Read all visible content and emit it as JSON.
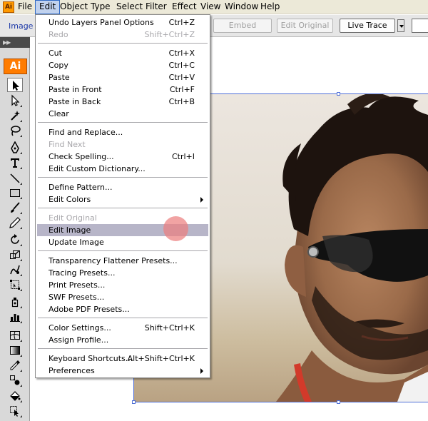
{
  "app": {
    "icon": "Ai"
  },
  "menubar": {
    "items": [
      "File",
      "Edit",
      "Object",
      "Type",
      "Select",
      "Filter",
      "Effect",
      "View",
      "Window",
      "Help"
    ],
    "active": "Edit"
  },
  "controlbar": {
    "selection_label": "Image",
    "embed": "Embed",
    "edit_original": "Edit Original",
    "live_trace": "Live Trace"
  },
  "tools": {
    "logo": "Ai",
    "icons": [
      "selection-tool-icon",
      "direct-selection-tool-icon",
      "magic-wand-tool-icon",
      "lasso-tool-icon",
      "pen-tool-icon",
      "type-tool-icon",
      "line-segment-tool-icon",
      "rectangle-tool-icon",
      "paintbrush-tool-icon",
      "pencil-tool-icon",
      "rotate-tool-icon",
      "scale-tool-icon",
      "warp-tool-icon",
      "free-transform-tool-icon",
      "symbol-sprayer-tool-icon",
      "column-graph-tool-icon",
      "mesh-tool-icon",
      "gradient-tool-icon",
      "eyedropper-tool-icon",
      "blend-tool-icon",
      "live-paint-bucket-tool-icon",
      "live-paint-selection-tool-icon"
    ]
  },
  "edit_menu": {
    "items": [
      {
        "label": "Undo Layers Panel Options",
        "shortcut": "Ctrl+Z",
        "enabled": true
      },
      {
        "label": "Redo",
        "shortcut": "Shift+Ctrl+Z",
        "enabled": false
      },
      {
        "label": "Cut",
        "shortcut": "Ctrl+X",
        "enabled": true
      },
      {
        "label": "Copy",
        "shortcut": "Ctrl+C",
        "enabled": true
      },
      {
        "label": "Paste",
        "shortcut": "Ctrl+V",
        "enabled": true
      },
      {
        "label": "Paste in Front",
        "shortcut": "Ctrl+F",
        "enabled": true
      },
      {
        "label": "Paste in Back",
        "shortcut": "Ctrl+B",
        "enabled": true
      },
      {
        "label": "Clear",
        "shortcut": "",
        "enabled": true
      },
      {
        "label": "Find and Replace...",
        "shortcut": "",
        "enabled": true
      },
      {
        "label": "Find Next",
        "shortcut": "",
        "enabled": false
      },
      {
        "label": "Check Spelling...",
        "shortcut": "Ctrl+I",
        "enabled": true
      },
      {
        "label": "Edit Custom Dictionary...",
        "shortcut": "",
        "enabled": true
      },
      {
        "label": "Define Pattern...",
        "shortcut": "",
        "enabled": true
      },
      {
        "label": "Edit Colors",
        "shortcut": "",
        "enabled": true,
        "submenu": true
      },
      {
        "label": "Edit Original",
        "shortcut": "",
        "enabled": false
      },
      {
        "label": "Edit Image",
        "shortcut": "",
        "enabled": true,
        "highlighted": true
      },
      {
        "label": "Update Image",
        "shortcut": "",
        "enabled": true
      },
      {
        "label": "Transparency Flattener Presets...",
        "shortcut": "",
        "enabled": true
      },
      {
        "label": "Tracing Presets...",
        "shortcut": "",
        "enabled": true
      },
      {
        "label": "Print Presets...",
        "shortcut": "",
        "enabled": true
      },
      {
        "label": "SWF Presets...",
        "shortcut": "",
        "enabled": true
      },
      {
        "label": "Adobe PDF Presets...",
        "shortcut": "",
        "enabled": true
      },
      {
        "label": "Color Settings...",
        "shortcut": "Shift+Ctrl+K",
        "enabled": true
      },
      {
        "label": "Assign Profile...",
        "shortcut": "",
        "enabled": true
      },
      {
        "label": "Keyboard Shortcuts...",
        "shortcut": "Alt+Shift+Ctrl+K",
        "enabled": true
      },
      {
        "label": "Preferences",
        "shortcut": "",
        "enabled": true,
        "submenu": true
      }
    ]
  },
  "colors": {
    "accent": "#316ac5",
    "highlight": "#b7b5c8",
    "selection_frame": "#4f6fd7",
    "disabled_text": "#a7a6aa"
  }
}
